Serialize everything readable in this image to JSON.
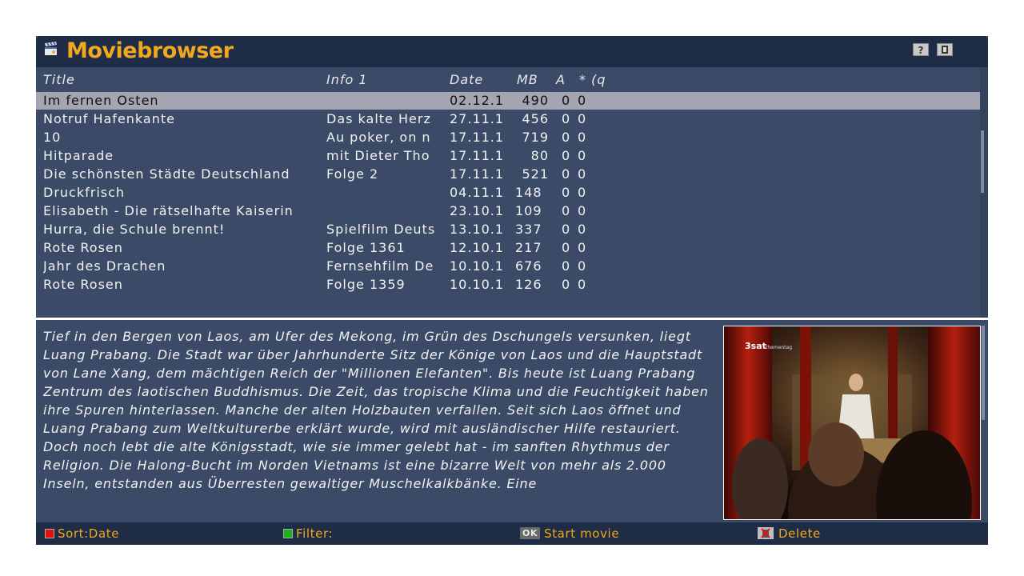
{
  "window": {
    "title": "Moviebrowser",
    "accent": "#f2a81e"
  },
  "title_buttons": [
    {
      "name": "help",
      "label": "?"
    },
    {
      "name": "info",
      "label": ""
    }
  ],
  "columns": {
    "title": "Title",
    "info": "Info 1",
    "date": "Date",
    "mb": "MB",
    "a": "A",
    "q": "* (q"
  },
  "rows": [
    {
      "title": "Im fernen Osten",
      "info": "",
      "date": "02.12.1",
      "mb": "490",
      "a": "0",
      "q": "0",
      "selected": true
    },
    {
      "title": "Notruf Hafenkante",
      "info": "Das kalte Herz",
      "date": "27.11.1",
      "mb": "456",
      "a": "0",
      "q": "0"
    },
    {
      "title": "10",
      "info": "Au poker, on n",
      "date": "17.11.1",
      "mb": "719",
      "a": "0",
      "q": "0"
    },
    {
      "title": "Hitparade",
      "info": "mit Dieter Tho",
      "date": "17.11.1",
      "mb": "80",
      "a": "0",
      "q": "0"
    },
    {
      "title": "Die schönsten Städte Deutschland",
      "info": "Folge 2",
      "date": "17.11.1",
      "mb": "521",
      "a": "0",
      "q": "0"
    },
    {
      "title": "Druckfrisch",
      "info": "",
      "date": "04.11.1",
      "mb": "148",
      "a": "0",
      "q": "0"
    },
    {
      "title": "Elisabeth - Die rätselhafte Kaiserin",
      "info": "",
      "date": "23.10.1",
      "mb": "109",
      "a": "0",
      "q": "0"
    },
    {
      "title": "Hurra, die Schule brennt!",
      "info": "Spielfilm Deuts",
      "date": "13.10.1",
      "mb": "337",
      "a": "0",
      "q": "0"
    },
    {
      "title": "Rote Rosen",
      "info": "Folge 1361",
      "date": "12.10.1",
      "mb": "217",
      "a": "0",
      "q": "0"
    },
    {
      "title": "Jahr des Drachen",
      "info": "Fernsehfilm De",
      "date": "10.10.1",
      "mb": "676",
      "a": "0",
      "q": "0"
    },
    {
      "title": "Rote Rosen",
      "info": "Folge 1359",
      "date": "10.10.1",
      "mb": "126",
      "a": "0",
      "q": "0"
    }
  ],
  "description": "Tief in den Bergen von Laos, am Ufer des Mekong, im Grün des Dschungels versunken, liegt Luang Prabang. Die Stadt war über Jahrhunderte Sitz der Könige von Laos und die Hauptstadt von Lane Xang, dem mächtigen Reich der \"Millionen Elefanten\". Bis heute ist Luang Prabang Zentrum des laotischen Buddhismus. Die Zeit, das tropische Klima und die Feuchtigkeit haben ihre Spuren hinterlassen. Manche der alten Holzbauten verfallen. Seit sich Laos öffnet und Luang Prabang zum Weltkulturerbe erklärt wurde, wird mit ausländischer Hilfe restauriert. Doch noch lebt die alte Königsstadt, wie sie immer gelebt hat - im sanften Rhythmus der Religion. Die Halong-Bucht im Norden Vietnams ist eine bizarre Welt von mehr als 2.000 Inseln, entstanden aus Überresten gewaltiger Muschelkalkbänke. Eine",
  "thumbnail": {
    "channel_logo": "3sat",
    "channel_sub": "thementag"
  },
  "footer": {
    "red_label": "Sort:Date",
    "green_label": "Filter:",
    "ok_key": "OK",
    "ok_label": "Start movie",
    "delete_label": "Delete"
  },
  "colors": {
    "background": "#3b4a66",
    "bar": "#1e2c46",
    "selection": "#a4a4b2",
    "red": "#e01010",
    "green": "#19b019"
  }
}
